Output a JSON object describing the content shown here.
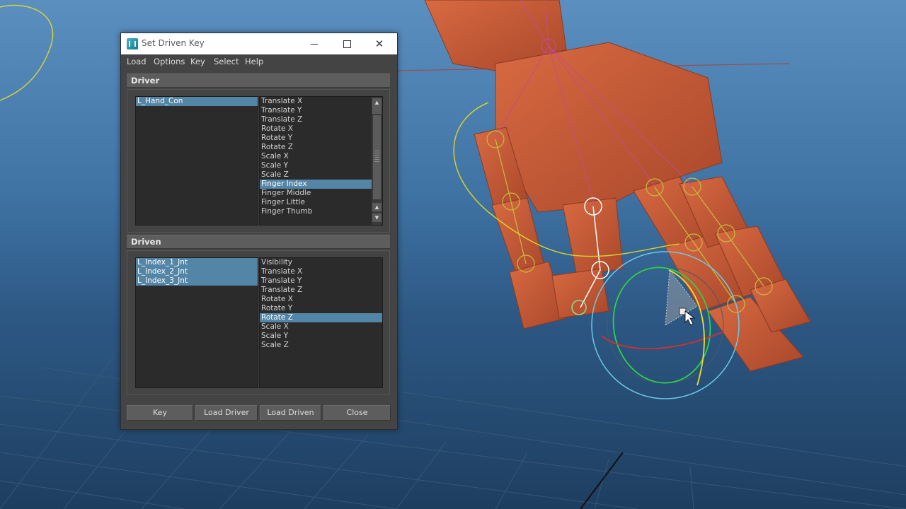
{
  "window": {
    "title": "Set Driven Key",
    "app_icon": "maya-icon",
    "controls": [
      "minimize-icon",
      "maximize-icon",
      "close-icon"
    ]
  },
  "menu": [
    "Load",
    "Options",
    "Key",
    "Select",
    "Help"
  ],
  "driver": {
    "header": "Driver",
    "objects": [
      {
        "label": "L_Hand_Con",
        "selected": true
      }
    ],
    "attributes": [
      {
        "label": "Translate X",
        "selected": false
      },
      {
        "label": "Translate Y",
        "selected": false
      },
      {
        "label": "Translate Z",
        "selected": false
      },
      {
        "label": "Rotate X",
        "selected": false
      },
      {
        "label": "Rotate Y",
        "selected": false
      },
      {
        "label": "Rotate Z",
        "selected": false
      },
      {
        "label": "Scale X",
        "selected": false
      },
      {
        "label": "Scale Y",
        "selected": false
      },
      {
        "label": "Scale Z",
        "selected": false
      },
      {
        "label": "Finger Index",
        "selected": true
      },
      {
        "label": "Finger Middle",
        "selected": false
      },
      {
        "label": "Finger Little",
        "selected": false
      },
      {
        "label": "Finger Thumb",
        "selected": false
      }
    ]
  },
  "driven": {
    "header": "Driven",
    "objects": [
      {
        "label": "L_Index_1_Jnt",
        "selected": true
      },
      {
        "label": "L_Index_2_Jnt",
        "selected": true
      },
      {
        "label": "L_Index_3_Jnt",
        "selected": true
      }
    ],
    "attributes": [
      {
        "label": "Visibility",
        "selected": false
      },
      {
        "label": "Translate X",
        "selected": false
      },
      {
        "label": "Translate Y",
        "selected": false
      },
      {
        "label": "Translate Z",
        "selected": false
      },
      {
        "label": "Rotate X",
        "selected": false
      },
      {
        "label": "Rotate Y",
        "selected": false
      },
      {
        "label": "Rotate Z",
        "selected": true
      },
      {
        "label": "Scale X",
        "selected": false
      },
      {
        "label": "Scale Y",
        "selected": false
      },
      {
        "label": "Scale Z",
        "selected": false
      }
    ]
  },
  "buttons": {
    "key": "Key",
    "load_driver": "Load Driver",
    "load_driven": "Load Driven",
    "close": "Close"
  },
  "colors": {
    "viewport_top": "#5b8fbf",
    "viewport_bottom": "#1e3e60",
    "hand_mesh": "#c85a35",
    "selection": "#5285a6",
    "joint": "#d6c63a",
    "rotate_manip_outer": "#6cc8e8"
  }
}
